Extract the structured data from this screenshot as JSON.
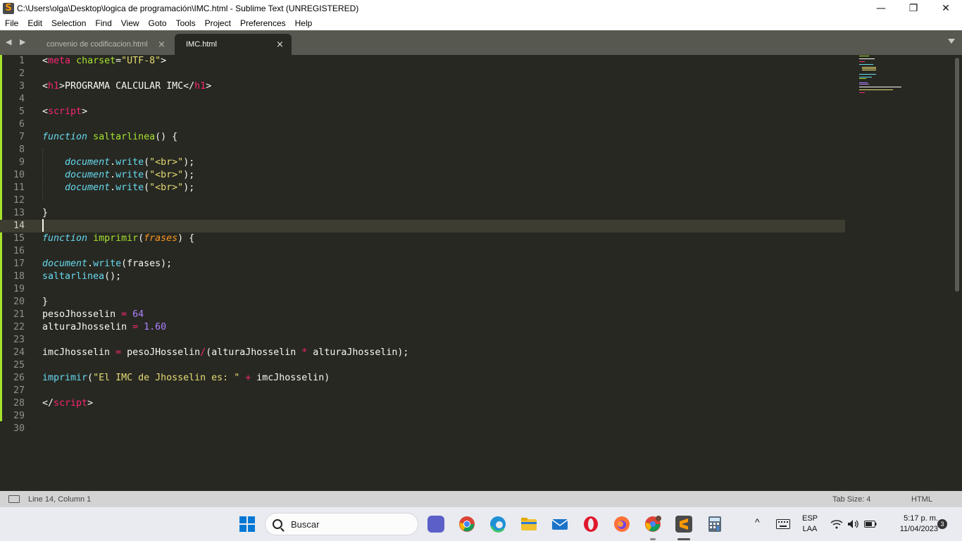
{
  "window": {
    "title": "C:\\Users\\olga\\Desktop\\logica de programación\\IMC.html - Sublime Text (UNREGISTERED)",
    "app_icon": "S",
    "controls": {
      "minimize": "—",
      "restore": "❐",
      "close": "✕"
    }
  },
  "menu": [
    "File",
    "Edit",
    "Selection",
    "Find",
    "View",
    "Goto",
    "Tools",
    "Project",
    "Preferences",
    "Help"
  ],
  "tabs": [
    {
      "label": "convenio de codificacion.html",
      "close": "×",
      "active": false
    },
    {
      "label": "IMC.html",
      "close": "×",
      "active": true
    }
  ],
  "nav_arrows": "◀ ▶",
  "editor": {
    "line_numbers": [
      "1",
      "2",
      "3",
      "4",
      "5",
      "6",
      "7",
      "8",
      "9",
      "10",
      "11",
      "12",
      "13",
      "14",
      "15",
      "16",
      "17",
      "18",
      "19",
      "20",
      "21",
      "22",
      "23",
      "24",
      "25",
      "26",
      "27",
      "28",
      "29",
      "30"
    ],
    "code": {
      "l1": [
        "<",
        "meta",
        " ",
        "charset",
        "=",
        "\"UTF-8\"",
        ">"
      ],
      "l3": [
        "<",
        "h1",
        ">PROGRAMA CALCULAR IMC</",
        "h1",
        ">"
      ],
      "l5": [
        "<",
        "script",
        ">"
      ],
      "l7": [
        "function",
        " ",
        "saltarlinea",
        "() {"
      ],
      "l9": [
        "    ",
        "document",
        ".",
        "write",
        "(",
        "\"<br>\"",
        ");"
      ],
      "l10": [
        "    ",
        "document",
        ".",
        "write",
        "(",
        "\"<br>\"",
        ");"
      ],
      "l11": [
        "    ",
        "document",
        ".",
        "write",
        "(",
        "\"<br>\"",
        ");"
      ],
      "l13": [
        "}"
      ],
      "l15": [
        "function",
        " ",
        "imprimir",
        "(",
        "frases",
        ") {"
      ],
      "l17": [
        "document",
        ".",
        "write",
        "(frases);"
      ],
      "l18": [
        "saltarlinea",
        "();"
      ],
      "l20": [
        "}"
      ],
      "l21": [
        "pesoJhosselin ",
        "=",
        " ",
        "64"
      ],
      "l22": [
        "alturaJhosselin ",
        "=",
        " ",
        "1.60"
      ],
      "l24": [
        "imcJhosselin ",
        "=",
        " pesoJHosselin",
        "/",
        "(alturaJhosselin ",
        "*",
        " alturaJhosselin);"
      ],
      "l26": [
        "imprimir",
        "(",
        "\"El IMC de Jhosselin es: \"",
        " ",
        "+",
        " imcJhosselin)"
      ],
      "l28": [
        "</",
        "script",
        ">"
      ]
    }
  },
  "status": {
    "position": "Line 14, Column 1",
    "tab_size": "Tab Size: 4",
    "syntax": "HTML"
  },
  "taskbar": {
    "search_placeholder": "Buscar",
    "lang_top": "ESP",
    "lang_bottom": "LAA",
    "time": "5:17 p. m.",
    "date": "11/04/2023",
    "notifications": "3",
    "tray_chevron": "^"
  },
  "colors": {
    "editor_bg": "#272822",
    "tag": "#f92672",
    "attr": "#a6e22e",
    "string": "#e6db74",
    "keyword": "#66d9ef",
    "number": "#ae81ff",
    "param": "#fd971f"
  }
}
